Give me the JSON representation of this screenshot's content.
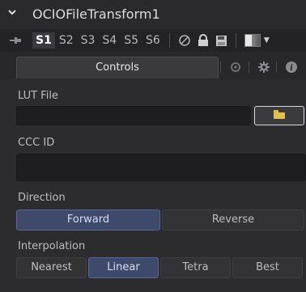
{
  "title": {
    "collapse_icon": "chevron-down-icon",
    "text": "OCIOFileTransform1"
  },
  "versions": {
    "pin_icon": "pin-icon",
    "buttons": [
      "S1",
      "S2",
      "S3",
      "S4",
      "S5",
      "S6"
    ],
    "active_index": 0,
    "tool_icons": [
      "disable-icon",
      "lock-icon",
      "save-icon"
    ],
    "color_icon": "color-swatch-icon"
  },
  "tabs": {
    "active_label": "Controls",
    "icons": [
      "settings-tab-icon",
      "gear-icon",
      "info-icon"
    ]
  },
  "lut_file": {
    "label": "LUT File",
    "value": "",
    "browse_icon": "folder-icon"
  },
  "ccc_id": {
    "label": "CCC ID",
    "value": ""
  },
  "direction": {
    "label": "Direction",
    "options": [
      "Forward",
      "Reverse"
    ],
    "selected": "Forward"
  },
  "interpolation": {
    "label": "Interpolation",
    "options": [
      "Nearest",
      "Linear",
      "Tetra",
      "Best"
    ],
    "selected": "Linear"
  },
  "colors": {
    "selected_button": "#3d4a6b",
    "folder": "#e3c04a",
    "panel": "#2c2c2f"
  }
}
